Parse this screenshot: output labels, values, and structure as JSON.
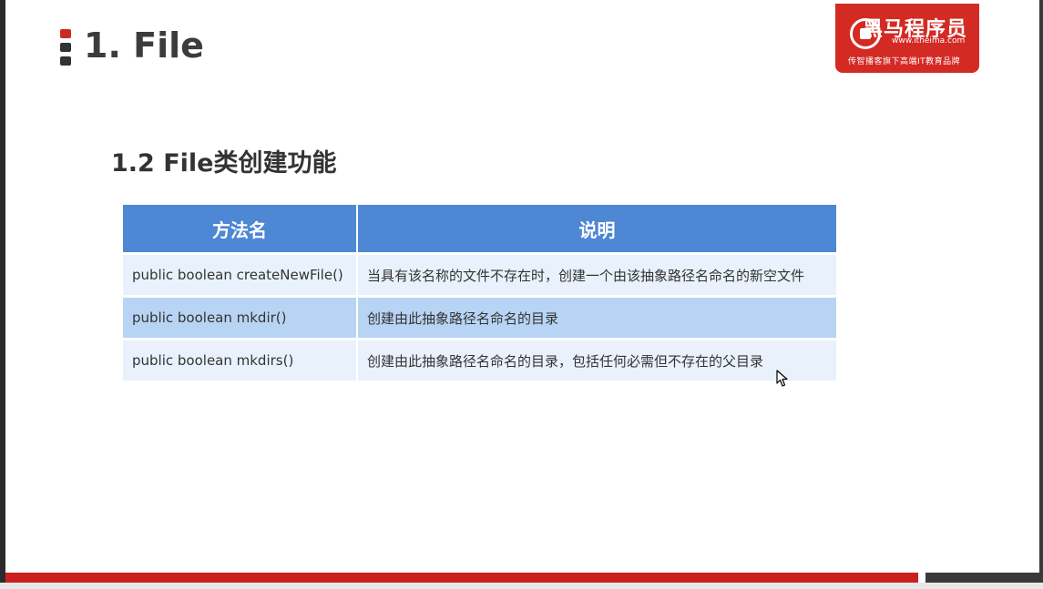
{
  "slide": {
    "main_title": "1. File",
    "section_title": "1.2 File类创建功能"
  },
  "logo": {
    "name": "黑马程序员",
    "url": "www.itheima.com",
    "tagline": "传智播客旗下高端IT教育品牌",
    "accent_color": "#d42a24"
  },
  "table": {
    "headers": [
      "方法名",
      "说明"
    ],
    "rows": [
      {
        "method": "public boolean createNewFile()",
        "description": "当具有该名称的文件不存在时，创建一个由该抽象路径名命名的新空文件"
      },
      {
        "method": "public boolean mkdir()",
        "description": "创建由此抽象路径名命名的目录"
      },
      {
        "method": "public boolean mkdirs()",
        "description": "创建由此抽象路径名命名的目录，包括任何必需但不存在的父目录"
      }
    ],
    "header_color": "#4e87d4",
    "row_colors": [
      "#e9f2fc",
      "#b8d4f4"
    ]
  },
  "icons": {
    "cursor": "mouse-pointer-icon"
  },
  "colors": {
    "bottom_bar": "#cc2020",
    "title_text": "#3c3c3c"
  }
}
